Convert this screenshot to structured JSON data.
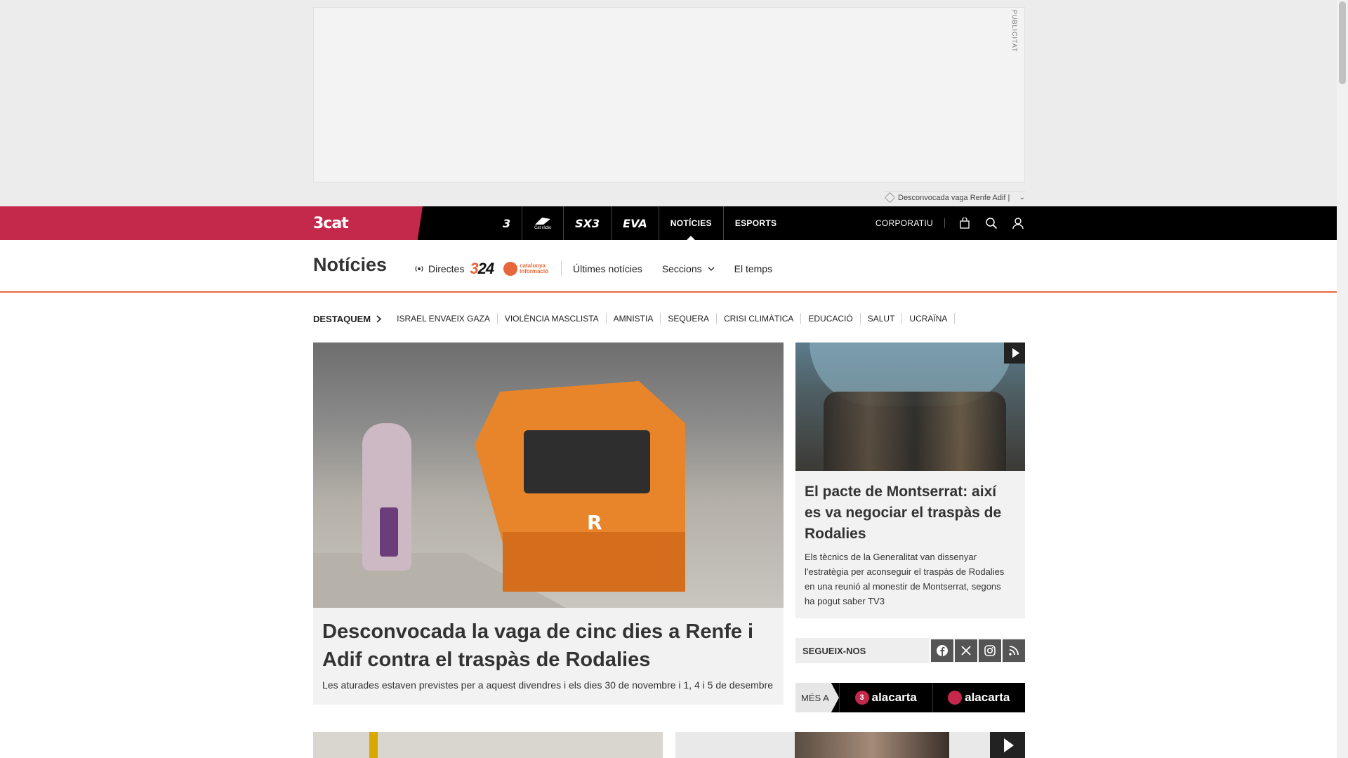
{
  "ad": {
    "label": "PUBLICITAT",
    "tagline": "Desconvocada vaga Renfe Adif |"
  },
  "topnav": {
    "brand": "3cat",
    "channels": [
      {
        "label": "3",
        "icon": "tv3-logo"
      },
      {
        "label": "Cat ràdio",
        "icon": "catradio-logo"
      },
      {
        "label": "SX3",
        "icon": "sx3-logo"
      },
      {
        "label": "EVA",
        "icon": "eva-logo"
      },
      {
        "label": "NOTÍCIES",
        "icon": ""
      },
      {
        "label": "ESPORTS",
        "icon": ""
      }
    ],
    "corporatiu": "CORPORATIU"
  },
  "section": {
    "title": "Notícies",
    "directes": "Directes",
    "logo_324": "24",
    "catinfo_line1": "catalunya",
    "catinfo_line2": "informació",
    "links": [
      "Últimes notícies",
      "Seccions",
      "El temps"
    ]
  },
  "tags": {
    "lead": "DESTAQUEM",
    "items": [
      "ISRAEL ENVAEIX GAZA",
      "VIOLÈNCIA MASCLISTA",
      "AMNISTIA",
      "SEQUERA",
      "CRISI CLIMÀTICA",
      "EDUCACIÓ",
      "SALUT",
      "UCRAÏNA"
    ]
  },
  "main_article": {
    "train_mark": "R",
    "title": "Desconvocada la vaga de cinc dies a Renfe i Adif contra el traspàs de Rodalies",
    "subtitle": "Les aturades estaven previstes per a aquest divendres i els dies 30 de novembre i 1, 4 i 5 de desembre"
  },
  "side_article": {
    "title": "El pacte de Montserrat: així es va negociar el traspàs de Rodalies",
    "subtitle": "Els tècnics de la Generalitat van dissenyar l'estratègia per aconseguir el traspàs de Rodalies en una reunió al monestir de Montserrat, segons ha pogut saber TV3"
  },
  "follow": {
    "label": "SEGUEIX-NOS",
    "networks": [
      "facebook-icon",
      "x-icon",
      "instagram-icon",
      "rss-icon"
    ]
  },
  "mesa": {
    "label": "MÉS A",
    "items": [
      {
        "badge": "3",
        "text": "alacarta"
      },
      {
        "badge": "",
        "text": "alacarta"
      }
    ]
  },
  "colors": {
    "brand": "#c4294b",
    "accent": "#e7673b",
    "nav": "#000000"
  }
}
